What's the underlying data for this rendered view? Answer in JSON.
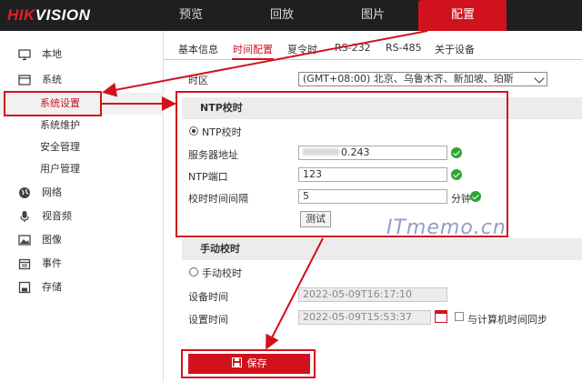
{
  "brand": {
    "part1": "HIK",
    "part2": "VISION"
  },
  "topnav": [
    {
      "label": "预览"
    },
    {
      "label": "回放"
    },
    {
      "label": "图片"
    },
    {
      "label": "配置",
      "active": true
    }
  ],
  "sidebar": [
    {
      "label": "本地",
      "icon": "monitor-icon"
    },
    {
      "label": "系统",
      "icon": "system-icon"
    },
    {
      "label": "系统设置",
      "active": true
    },
    {
      "label": "系统维护"
    },
    {
      "label": "安全管理"
    },
    {
      "label": "用户管理"
    },
    {
      "label": "网络",
      "icon": "globe-icon"
    },
    {
      "label": "视音频",
      "icon": "microphone-icon"
    },
    {
      "label": "图像",
      "icon": "image-icon"
    },
    {
      "label": "事件",
      "icon": "calendar-icon"
    },
    {
      "label": "存储",
      "icon": "disk-icon"
    }
  ],
  "tabs": [
    {
      "label": "基本信息"
    },
    {
      "label": "时间配置",
      "active": true
    },
    {
      "label": "夏令时"
    },
    {
      "label": "RS-232"
    },
    {
      "label": "RS-485"
    },
    {
      "label": "关于设备"
    }
  ],
  "timezone": {
    "label": "时区",
    "value": "(GMT+08:00) 北京、乌鲁木齐、新加坡、珀斯"
  },
  "ntp": {
    "section_title": "NTP校时",
    "radio_label": "NTP校时",
    "server_label": "服务器地址",
    "server_value": "0.243",
    "port_label": "NTP端口",
    "port_value": "123",
    "interval_label": "校时时间间隔",
    "interval_value": "5",
    "interval_unit": "分钟",
    "test_button": "测试"
  },
  "manual": {
    "section_title": "手动校时",
    "radio_label": "手动校时",
    "device_time_label": "设备时间",
    "device_time_value": "2022-05-09T16:17:10",
    "set_time_label": "设置时间",
    "set_time_value": "2022-05-09T15:53:37",
    "sync_label": "与计算机时间同步"
  },
  "save_button": "保存",
  "watermark": "ITmemo.cn",
  "colors": {
    "accent": "#d0121d",
    "ok": "#2fa52f",
    "topbar": "#1f1f1f"
  }
}
